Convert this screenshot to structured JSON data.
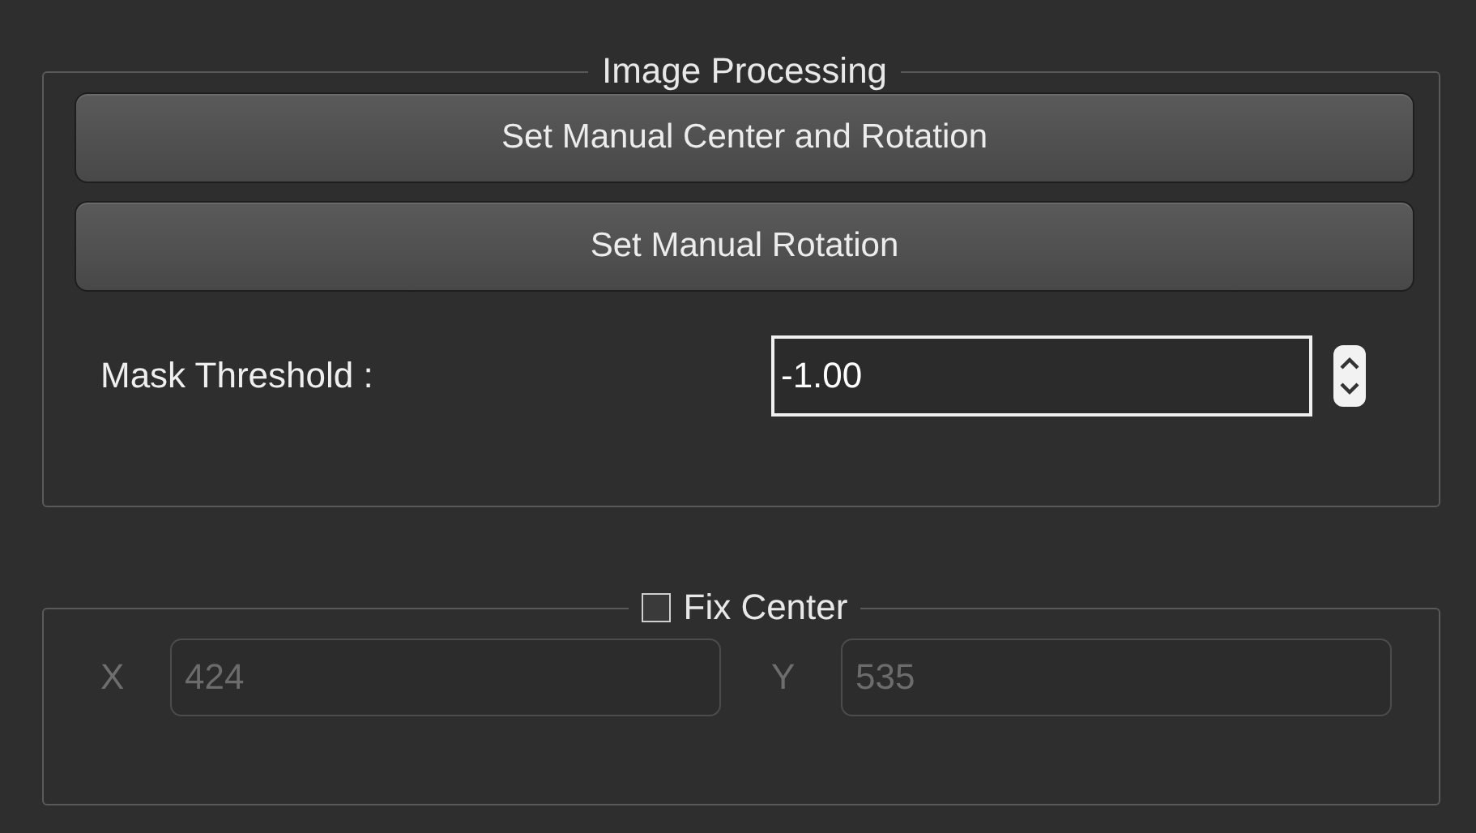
{
  "image_processing": {
    "title": "Image Processing",
    "buttons": [
      "Set Manual Center and Rotation",
      "Set Manual Rotation"
    ],
    "mask_threshold": {
      "label": "Mask Threshold :",
      "value": "-1.00"
    }
  },
  "fix_center": {
    "title": "Fix Center",
    "checked": false,
    "fields": [
      {
        "label": "X",
        "value": "424",
        "disabled": true
      },
      {
        "label": "Y",
        "value": "535",
        "disabled": true
      }
    ]
  }
}
